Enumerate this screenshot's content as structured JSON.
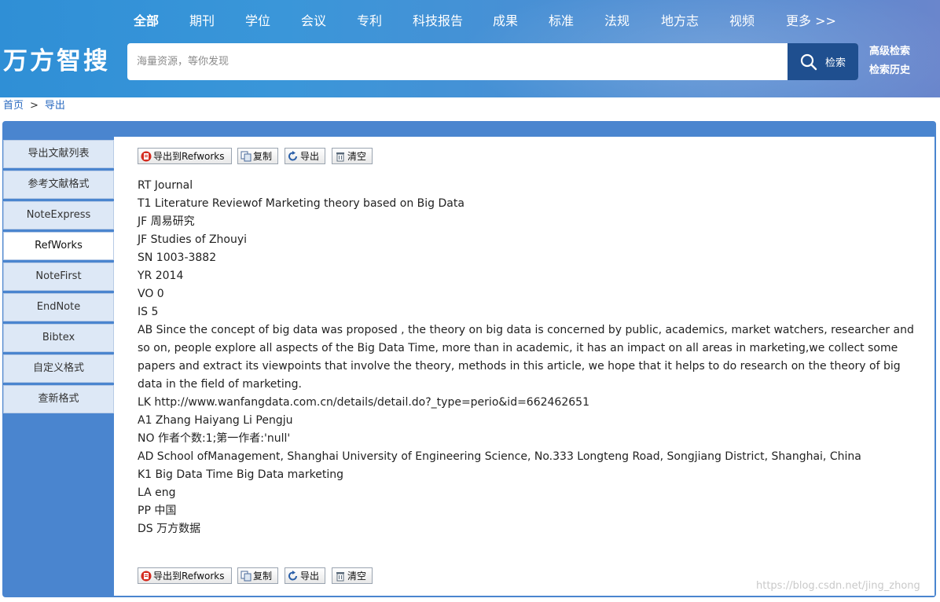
{
  "header": {
    "nav": [
      "全部",
      "期刊",
      "学位",
      "会议",
      "专利",
      "科技报告",
      "成果",
      "标准",
      "法规",
      "地方志",
      "视频",
      "更多 >>"
    ],
    "logo": "万方智搜",
    "search": {
      "placeholder": "海量资源，等你发现",
      "button_label": "检索"
    },
    "advanced_search": "高级检索",
    "search_history": "检索历史"
  },
  "breadcrumb": {
    "home": "首页",
    "separator": ">",
    "current": "导出"
  },
  "sidebar": {
    "items": [
      "导出文献列表",
      "参考文献格式",
      "NoteExpress",
      "RefWorks",
      "NoteFirst",
      "EndNote",
      "Bibtex",
      "自定义格式",
      "查新格式"
    ],
    "active": "RefWorks"
  },
  "toolbar": {
    "export_refworks": "导出到Refworks",
    "copy": "复制",
    "export": "导出",
    "clear": "清空"
  },
  "record": {
    "lines": [
      "RT Journal",
      "T1 Literature Reviewof Marketing theory based on Big Data",
      "JF 周易研究",
      "JF Studies of Zhouyi",
      "SN 1003-3882",
      "YR 2014",
      "VO 0",
      "IS 5",
      "AB Since the concept of big data was proposed , the theory on big data is concerned by public, academics, market watchers, researcher and so on, people explore all aspects of the Big Data Time, more than in academic, it has an impact on all areas in marketing,we collect some papers and extract its viewpoints that involve the theory, methods in this article, we hope that it helps to do research on the theory of big data in the field of marketing.",
      "LK http://www.wanfangdata.com.cn/details/detail.do?_type=perio&id=662462651",
      "A1 Zhang Haiyang Li Pengju",
      "NO 作者个数:1;第一作者:'null'",
      "AD School ofManagement, Shanghai University of Engineering Science, No.333 Longteng Road, Songjiang District, Shanghai, China",
      "K1 Big Data Time Big Data marketing",
      "LA eng",
      "PP 中国",
      "DS 万方数据"
    ]
  },
  "watermark": "https://blog.csdn.net/jing_zhong",
  "colors": {
    "header_blue": "#3a96d9",
    "search_button": "#1f4f8f",
    "panel_blue": "#4a85cf",
    "sidebar_item": "#dde8f6"
  }
}
